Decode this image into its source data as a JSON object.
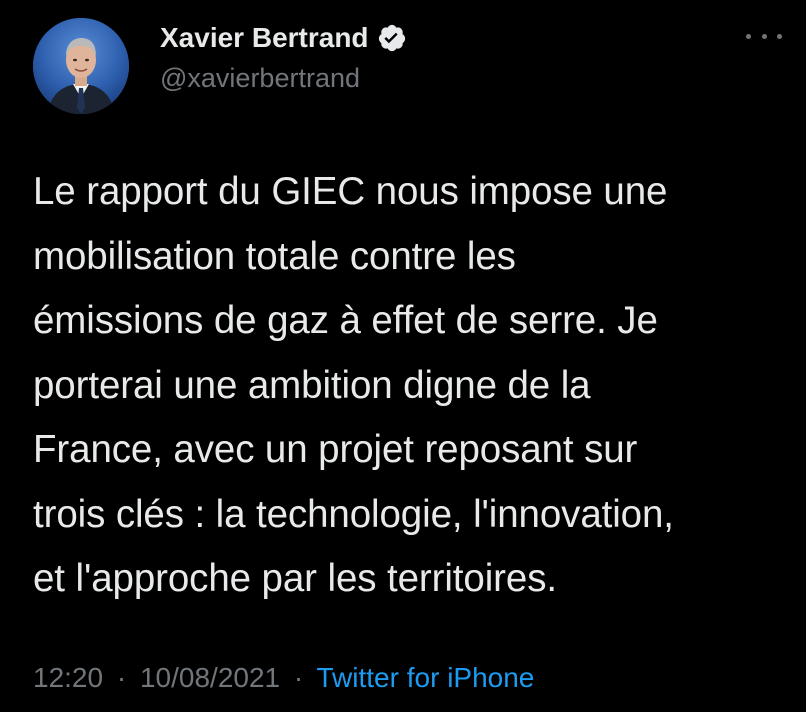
{
  "author": {
    "display_name": "Xavier Bertrand",
    "handle": "@xavierbertrand",
    "verified": true,
    "avatar_icon": "profile-photo"
  },
  "tweet": {
    "text": "Le rapport du GIEC nous impose une\nmobilisation totale contre les\némissions de gaz à effet de serre. Je\nporterai une ambition digne de la\nFrance, avec un projet reposant sur\ntrois clés : la technologie, l'innovation,\net l'approche par les territoires."
  },
  "meta": {
    "time": "12:20",
    "separator": "·",
    "date": "10/08/2021",
    "source": "Twitter for iPhone"
  },
  "colors": {
    "background": "#000000",
    "primary_text": "#e7e9ea",
    "secondary_text": "#71767b",
    "link": "#1d9bf0"
  },
  "icons": {
    "verified": "verified-badge-icon",
    "more": "more-options-icon"
  }
}
